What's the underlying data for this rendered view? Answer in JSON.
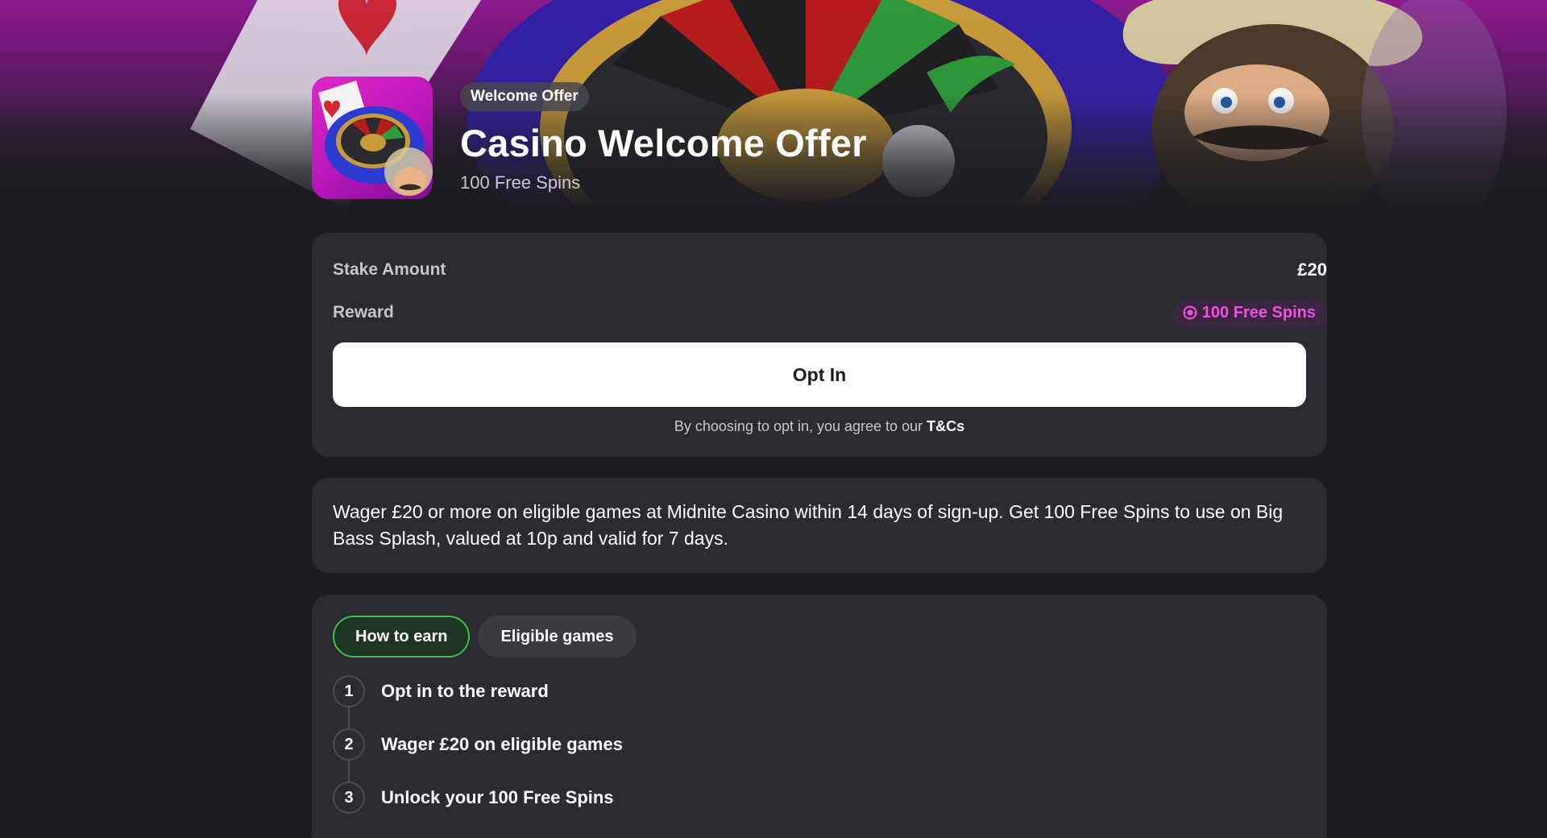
{
  "hero": {
    "badge": "Welcome Offer",
    "title": "Casino Welcome Offer",
    "subtitle": "100 Free Spins"
  },
  "stake_card": {
    "stake_label": "Stake Amount",
    "stake_value": "£20",
    "reward_label": "Reward",
    "reward_value": "100 Free Spins",
    "reward_icon": "spin-chip-icon",
    "opt_in_label": "Opt In",
    "terms_text": "By choosing to opt in, you agree to our ",
    "terms_link": "T&Cs"
  },
  "description": "Wager £20 or more on eligible games at Midnite Casino within 14 days of sign-up. Get 100 Free Spins to use on Big Bass Splash, valued at 10p and valid for 7 days.",
  "earn": {
    "tabs": [
      {
        "label": "How to earn",
        "active": true
      },
      {
        "label": "Eligible games",
        "active": false
      }
    ],
    "steps": [
      {
        "number": "1",
        "text": "Opt in to the reward"
      },
      {
        "number": "2",
        "text": "Wager £20 on eligible games"
      },
      {
        "number": "3",
        "text": "Unlock your 100 Free Spins"
      }
    ]
  },
  "colors": {
    "background": "#1c1d20",
    "card": "#2b2c30",
    "accent_green": "#3cc24a",
    "accent_pink": "#f050e0",
    "hero_purple": "#8f1a8f"
  }
}
